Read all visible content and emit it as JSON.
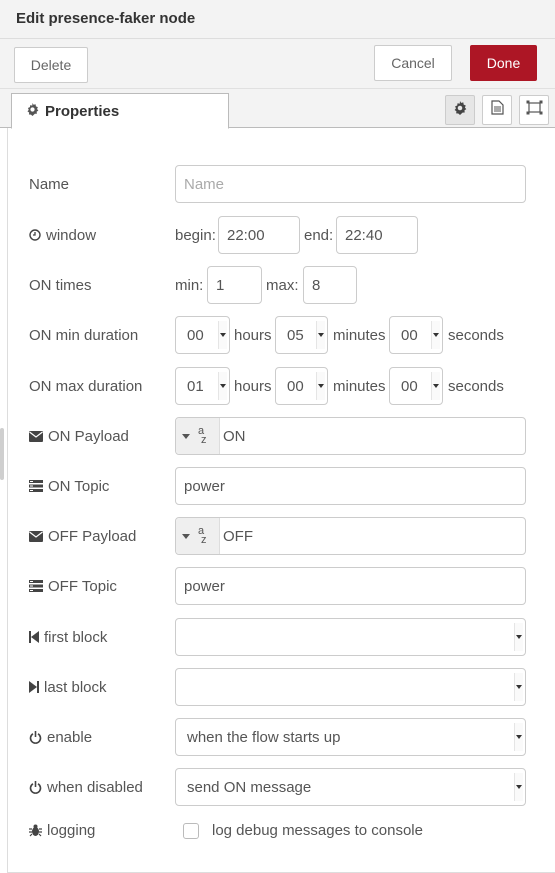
{
  "header": {
    "title": "Edit presence-faker node"
  },
  "toolbar": {
    "delete_label": "Delete",
    "cancel_label": "Cancel",
    "done_label": "Done"
  },
  "tabs": {
    "properties_label": "Properties",
    "icons": [
      "gear-icon",
      "description-icon",
      "appearance-icon"
    ]
  },
  "colors": {
    "done_bg": "#ad1625",
    "header_bg": "#f3f3f3",
    "label": "#555555"
  },
  "form": {
    "name": {
      "label": "Name",
      "placeholder": "Name",
      "value": ""
    },
    "window": {
      "label": "window",
      "begin_label": "begin:",
      "begin_value": "22:00",
      "end_label": "end:",
      "end_value": "22:40"
    },
    "on_times": {
      "label": "ON times",
      "min_label": "min:",
      "min_value": "1",
      "max_label": "max:",
      "max_value": "8"
    },
    "on_min_duration": {
      "label": "ON min duration",
      "hours": "00",
      "hours_label": "hours",
      "minutes": "05",
      "minutes_label": "minutes",
      "seconds": "00",
      "seconds_label": "seconds"
    },
    "on_max_duration": {
      "label": "ON max duration",
      "hours": "01",
      "hours_label": "hours",
      "minutes": "00",
      "minutes_label": "minutes",
      "seconds": "00",
      "seconds_label": "seconds"
    },
    "on_payload": {
      "label": "ON Payload",
      "type_glyph": "az",
      "value": "ON"
    },
    "on_topic": {
      "label": "ON Topic",
      "value": "power"
    },
    "off_payload": {
      "label": "OFF Payload",
      "type_glyph": "az",
      "value": "OFF"
    },
    "off_topic": {
      "label": "OFF Topic",
      "value": "power"
    },
    "first_block": {
      "label": "first block",
      "value": ""
    },
    "last_block": {
      "label": "last block",
      "value": ""
    },
    "enable": {
      "label": "enable",
      "value": "when the flow starts up"
    },
    "when_disabled": {
      "label": "when disabled",
      "value": "send ON message"
    },
    "logging": {
      "label": "logging",
      "checkbox_label": "log debug messages to console",
      "checked": false
    }
  }
}
